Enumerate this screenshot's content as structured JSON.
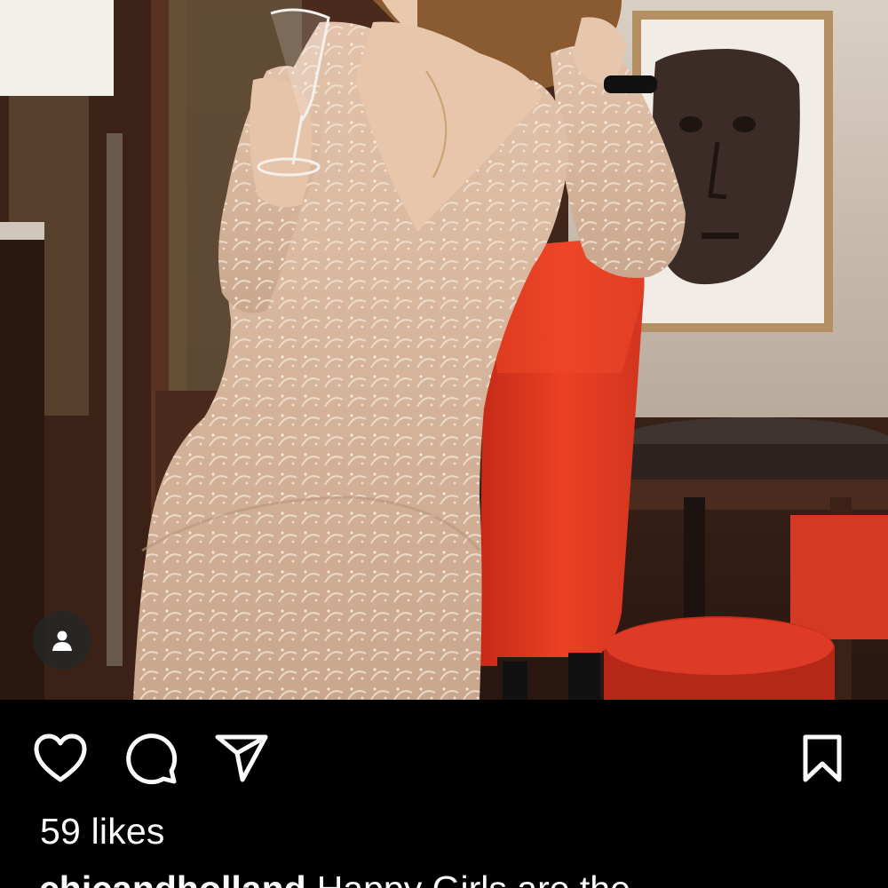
{
  "post": {
    "photo_alt": "",
    "tag_icon": "person-icon",
    "actions": {
      "like_icon": "heart-outline-icon",
      "comment_icon": "speech-bubble-icon",
      "share_icon": "paper-plane-icon",
      "save_icon": "bookmark-outline-icon"
    },
    "likes_text": "59 likes",
    "caption": {
      "username": "chicandholland",
      "text": "Happy Girls are the"
    }
  },
  "colors": {
    "background": "#000000",
    "text": "#fafafa",
    "chair_red": "#e2381f",
    "dress_nude": "#d9b69c"
  }
}
